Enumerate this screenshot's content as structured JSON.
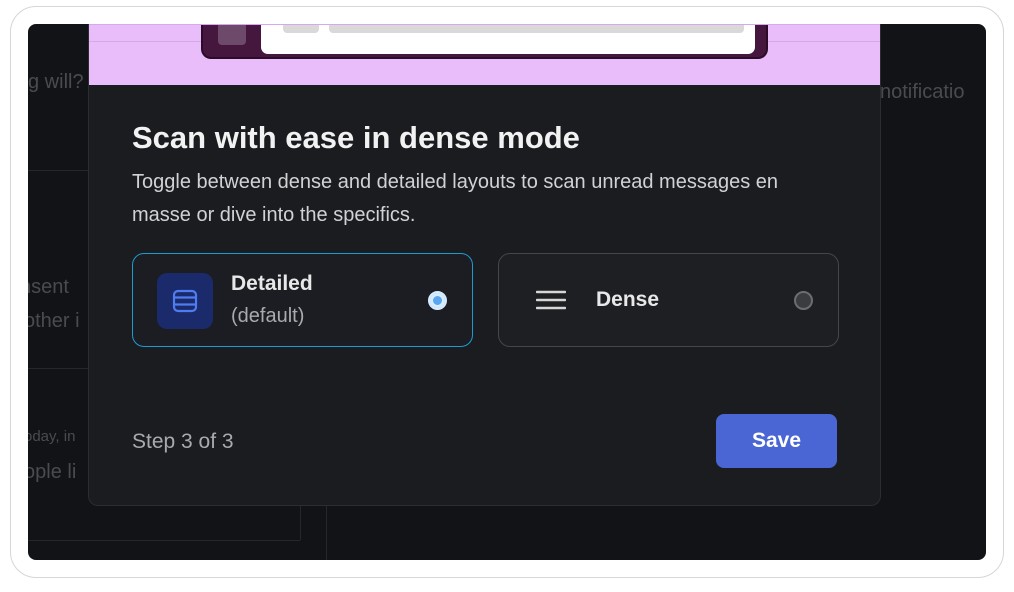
{
  "background": {
    "snippets": [
      "g will?",
      "nsent",
      "other i",
      "oday, in",
      "ople li",
      "notificatio"
    ]
  },
  "modal": {
    "title": "Scan with ease in dense mode",
    "description": "Toggle between dense and detailed layouts to scan unread messages en masse or dive into the specifics.",
    "options": [
      {
        "label": "Detailed",
        "sublabel": "(default)",
        "selected": true,
        "icon": "list-layout-icon"
      },
      {
        "label": "Dense",
        "selected": false,
        "icon": "menu-lines-icon"
      }
    ],
    "step_text": "Step 3 of 3",
    "save_label": "Save"
  },
  "colors": {
    "hero": "#e9bdfa",
    "accent": "#4a66d4",
    "selected_border": "#1d9bd1"
  }
}
